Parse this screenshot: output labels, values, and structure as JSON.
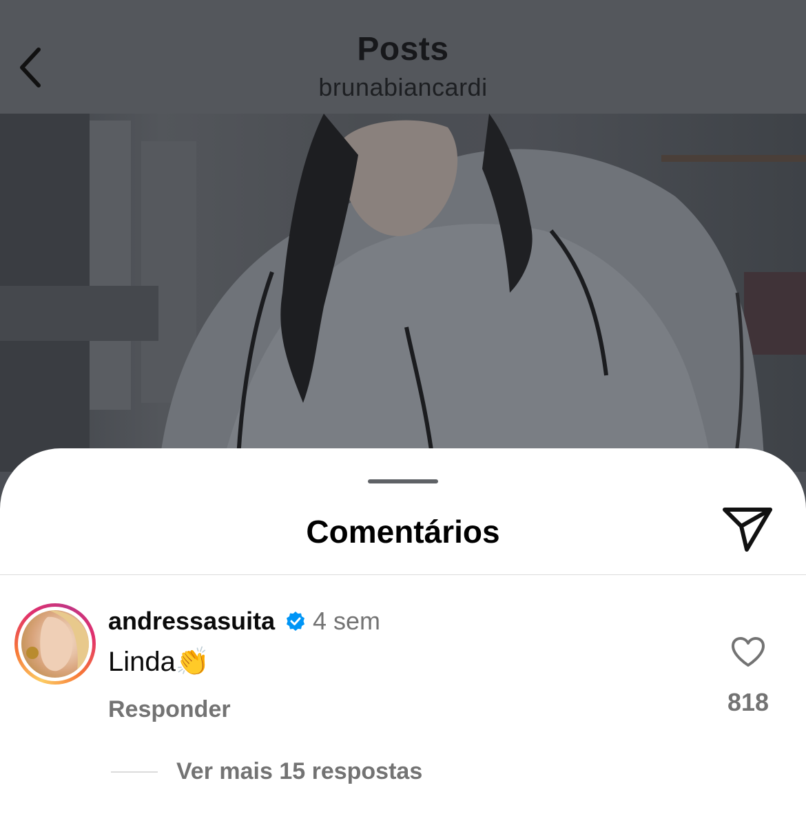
{
  "header": {
    "title": "Posts",
    "subtitle": "brunabiancardi"
  },
  "sheet": {
    "title": "Comentários"
  },
  "comment": {
    "username": "andressasuita",
    "time": "4 sem",
    "text": "Linda",
    "emoji": "👏",
    "reply_label": "Responder",
    "likes": "818",
    "view_more": "Ver mais 15 respostas"
  },
  "icons": {
    "back": "chevron-left-icon",
    "share": "paper-plane-icon",
    "like": "heart-icon",
    "verified": "verified-badge-icon"
  },
  "colors": {
    "verified": "#0095f6",
    "secondary_text": "#737373",
    "overlay": "#54575c"
  }
}
